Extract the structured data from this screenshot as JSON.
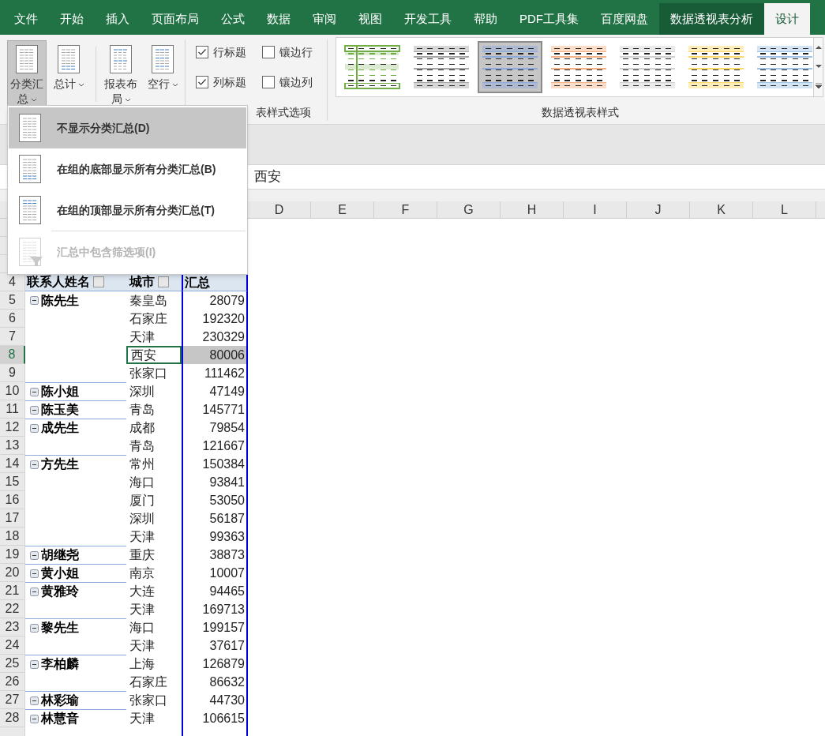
{
  "tabs": [
    {
      "label": "文件",
      "selected": false,
      "contextual": false
    },
    {
      "label": "开始",
      "selected": false,
      "contextual": false
    },
    {
      "label": "插入",
      "selected": false,
      "contextual": false
    },
    {
      "label": "页面布局",
      "selected": false,
      "contextual": false
    },
    {
      "label": "公式",
      "selected": false,
      "contextual": false
    },
    {
      "label": "数据",
      "selected": false,
      "contextual": false
    },
    {
      "label": "审阅",
      "selected": false,
      "contextual": false
    },
    {
      "label": "视图",
      "selected": false,
      "contextual": false
    },
    {
      "label": "开发工具",
      "selected": false,
      "contextual": false
    },
    {
      "label": "帮助",
      "selected": false,
      "contextual": false
    },
    {
      "label": "PDF工具集",
      "selected": false,
      "contextual": false
    },
    {
      "label": "百度网盘",
      "selected": false,
      "contextual": false
    },
    {
      "label": "数据透视表分析",
      "selected": false,
      "contextual": true
    },
    {
      "label": "设计",
      "selected": true,
      "contextual": true
    }
  ],
  "ribbon": {
    "layout_buttons": [
      {
        "label": "分类汇总",
        "pressed": true
      },
      {
        "label": "总计",
        "pressed": false
      },
      {
        "label": "报表布局",
        "pressed": false
      },
      {
        "label": "空行",
        "pressed": false
      }
    ],
    "style_options": [
      {
        "label": "行标题",
        "checked": true
      },
      {
        "label": "镶边行",
        "checked": false
      },
      {
        "label": "列标题",
        "checked": true
      },
      {
        "label": "镶边列",
        "checked": false
      }
    ],
    "style_options_label": "表样式选项",
    "styles": [
      {
        "color": "#70ad47",
        "selected": false
      },
      {
        "color": "#a5a5a5",
        "selected": false
      },
      {
        "color": "#8ea9db",
        "selected": true
      },
      {
        "color": "#f4b183",
        "selected": false
      },
      {
        "color": "#d0d0d0",
        "selected": false
      },
      {
        "color": "#ffd966",
        "selected": false
      },
      {
        "color": "#9dc3e6",
        "selected": false
      }
    ],
    "styles_label": "数据透视表样式"
  },
  "subtotals_menu": [
    {
      "label": "不显示分类汇总(D)",
      "kind": "none",
      "selected": true,
      "disabled": false
    },
    {
      "label": "在组的底部显示所有分类汇总(B)",
      "kind": "bottom",
      "selected": false,
      "disabled": false
    },
    {
      "label": "在组的顶部显示所有分类汇总(T)",
      "kind": "top",
      "selected": false,
      "disabled": false
    },
    {
      "label": "汇总中包含筛选项(I)",
      "kind": "filter",
      "selected": false,
      "disabled": true
    }
  ],
  "formula_bar": {
    "value": "西安"
  },
  "columns": [
    "D",
    "E",
    "F",
    "G",
    "H",
    "I",
    "J",
    "K",
    "L"
  ],
  "pivot": {
    "header_row": "4",
    "headers": [
      "联系人姓名",
      "城市",
      "汇总"
    ],
    "rows": [
      {
        "row": "5",
        "name": "陈先生",
        "city": "秦皇岛",
        "total": "28079",
        "selected": false
      },
      {
        "row": "6",
        "city": "石家庄",
        "total": "192320",
        "selected": false
      },
      {
        "row": "7",
        "city": "天津",
        "total": "230329",
        "selected": false
      },
      {
        "row": "8",
        "city": "西安",
        "total": "80006",
        "selected": true
      },
      {
        "row": "9",
        "city": "张家口",
        "total": "111462",
        "selected": false
      },
      {
        "row": "10",
        "name": "陈小姐",
        "city": "深圳",
        "total": "47149",
        "selected": false
      },
      {
        "row": "11",
        "name": "陈玉美",
        "city": "青岛",
        "total": "145771",
        "selected": false
      },
      {
        "row": "12",
        "name": "成先生",
        "city": "成都",
        "total": "79854",
        "selected": false
      },
      {
        "row": "13",
        "city": "青岛",
        "total": "121667",
        "selected": false
      },
      {
        "row": "14",
        "name": "方先生",
        "city": "常州",
        "total": "150384",
        "selected": false
      },
      {
        "row": "15",
        "city": "海口",
        "total": "93841",
        "selected": false
      },
      {
        "row": "16",
        "city": "厦门",
        "total": "53050",
        "selected": false
      },
      {
        "row": "17",
        "city": "深圳",
        "total": "56187",
        "selected": false
      },
      {
        "row": "18",
        "city": "天津",
        "total": "99363",
        "selected": false
      },
      {
        "row": "19",
        "name": "胡继尧",
        "city": "重庆",
        "total": "38873",
        "selected": false
      },
      {
        "row": "20",
        "name": "黄小姐",
        "city": "南京",
        "total": "10007",
        "selected": false
      },
      {
        "row": "21",
        "name": "黄雅玲",
        "city": "大连",
        "total": "94465",
        "selected": false
      },
      {
        "row": "22",
        "city": "天津",
        "total": "169713",
        "selected": false
      },
      {
        "row": "23",
        "name": "黎先生",
        "city": "海口",
        "total": "199157",
        "selected": false
      },
      {
        "row": "24",
        "city": "天津",
        "total": "37617",
        "selected": false
      },
      {
        "row": "25",
        "name": "李柏麟",
        "city": "上海",
        "total": "126879",
        "selected": false
      },
      {
        "row": "26",
        "city": "石家庄",
        "total": "86632",
        "selected": false
      },
      {
        "row": "27",
        "name": "林彩瑜",
        "city": "张家口",
        "total": "44730",
        "selected": false
      },
      {
        "row": "28",
        "name": "林慧音",
        "city": "天津",
        "total": "106615",
        "selected": false
      }
    ]
  }
}
